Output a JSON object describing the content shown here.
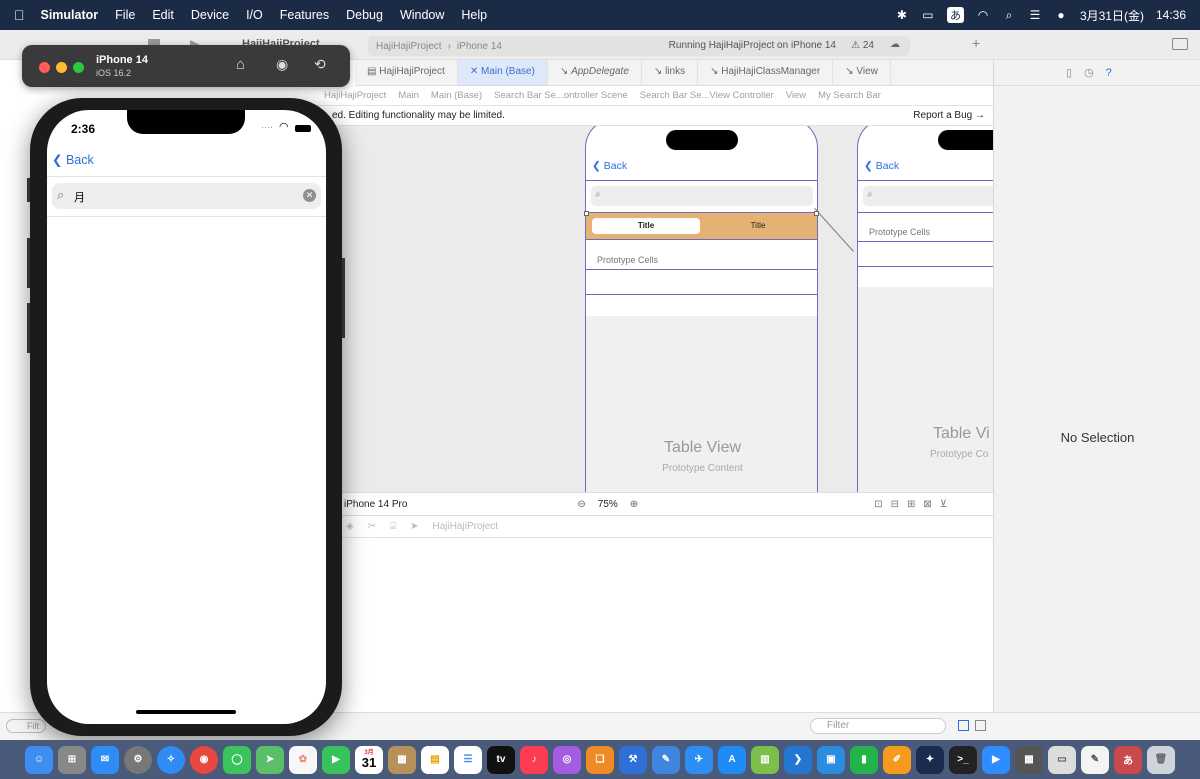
{
  "menubar": {
    "apple": "",
    "app_name": "Simulator",
    "items": [
      "File",
      "Edit",
      "Device",
      "I/O",
      "Features",
      "Debug",
      "Window",
      "Help"
    ],
    "ime": "あ",
    "date": "3月31日(金)",
    "time": "14:36"
  },
  "xcode": {
    "project_title": "HajiHajiProject",
    "activity": {
      "scheme": "HajiHajiProject",
      "destination": "iPhone 14",
      "status": "Running HajiHajiProject on iPhone 14",
      "warnings": "24"
    },
    "tabs": [
      "HajiHajiProject",
      "Main (Base)",
      "AppDelegate",
      "links",
      "HajiHajiClassManager",
      "View"
    ],
    "breadcrumbs": [
      "HajiHajiProject",
      "HajiHajiProject",
      "Main",
      "Main (Base)",
      "Search Bar Se...ontroller Scene",
      "Search Bar Se...View Controller",
      "View",
      "My Search Bar"
    ],
    "banner_text": "ed. Editing functionality may be limited.",
    "report_bug": "Report a Bug",
    "canvas": {
      "back_label": "Back",
      "segment_titles": [
        "Title",
        "Title"
      ],
      "prototype_cells": "Prototype Cells",
      "table_view": "Table View",
      "prototype_content": "Prototype Content",
      "phone2_table_view": "Table Vi",
      "phone2_prototype_content": "Prototype Co"
    },
    "device_label": "iPhone 14 Pro",
    "zoom": "75%",
    "debug_project": "HajiHajiProject",
    "inspector_empty": "No Selection",
    "filter_placeholder": "Filter",
    "filter_left": "Filt"
  },
  "simulator": {
    "device_name": "iPhone 14",
    "os_version": "iOS 16.2",
    "status_time": "2:36",
    "back_label": "Back",
    "search_text": "月"
  },
  "dock": {
    "calendar_month": "3月",
    "calendar_day": "31",
    "appletv": "tv",
    "ime_badge": "あ",
    "apps": [
      "Finder",
      "Launchpad",
      "Mail",
      "System Settings",
      "Safari",
      "Chrome",
      "Messages",
      "Maps",
      "Photos",
      "FaceTime",
      "Calendar",
      "Notes",
      "Reminders",
      "Apple TV",
      "Music",
      "Podcasts",
      "Books",
      "Xcode",
      "Simulator",
      "Testflight",
      "App Store",
      "Numbers Editor",
      "VS Code",
      "Keynote",
      "Numbers",
      "Pages",
      "Instruments",
      "Terminal",
      "Zoom",
      "Calculator",
      "Preview",
      "TextEdit",
      "Kotoeri",
      "Trash"
    ]
  },
  "colors": {
    "menubar_bg": "#1c2b45",
    "ios_blue": "#2b6fde",
    "storyboard_accent": "#6b6bc4",
    "segment_bg": "#e6b273"
  }
}
